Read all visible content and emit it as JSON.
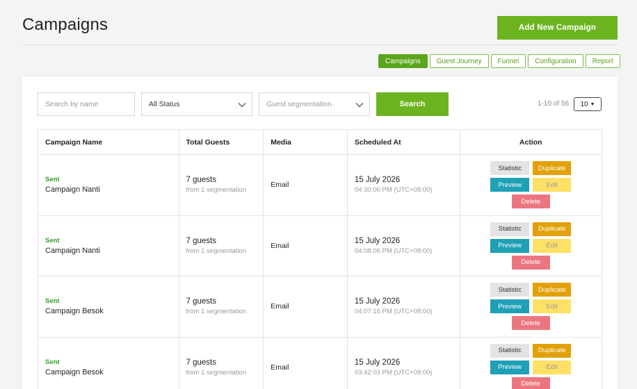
{
  "header": {
    "title": "Campaigns",
    "add_button": "Add New Campaign"
  },
  "tabs": [
    "Campaigns",
    "Guest Journey",
    "Funnel",
    "Configuration",
    "Report"
  ],
  "active_tab": "Campaigns",
  "filters": {
    "search_placeholder": "Search by name",
    "status_value": "All Status",
    "segmentation_placeholder": "Guest segmentation",
    "search_button": "Search"
  },
  "pagination": {
    "info": "1-10 of 56",
    "per_page": "10"
  },
  "table": {
    "columns": [
      "Campaign Name",
      "Total Guests",
      "Media",
      "Scheduled At",
      "Action"
    ],
    "rows": [
      {
        "status": "Sent",
        "name": "Campaign Nanti",
        "guests": "7 guests",
        "segmentation": "from 1 segmentation",
        "media": "Email",
        "date": "15 July 2026",
        "time": "04:30:00 PM (UTC+08:00)"
      },
      {
        "status": "Sent",
        "name": "Campaign Nanti",
        "guests": "7 guests",
        "segmentation": "from 1 segmentation",
        "media": "Email",
        "date": "15 July 2026",
        "time": "04:08:06 PM (UTC+08:00)"
      },
      {
        "status": "Sent",
        "name": "Campaign Besok",
        "guests": "7 guests",
        "segmentation": "from 1 segmentation",
        "media": "Email",
        "date": "15 July 2026",
        "time": "04:07:16 PM (UTC+08:00)"
      },
      {
        "status": "Sent",
        "name": "Campaign Besok",
        "guests": "7 guests",
        "segmentation": "from 1 segmentation",
        "media": "Email",
        "date": "15 July 2026",
        "time": "03:42:03 PM (UTC+08:00)"
      }
    ],
    "actions": {
      "statistic": "Statistic",
      "duplicate": "Duplicate",
      "preview": "Preview",
      "edit": "Edit",
      "delete": "Delete"
    }
  },
  "colors": {
    "primary_green": "#6cb41f",
    "sent_green": "#34a02b",
    "duplicate_orange": "#e2a109",
    "preview_teal": "#1ea0b5",
    "edit_yellow": "#ffe066",
    "delete_pink": "#ec7680"
  },
  "icons": {
    "dropdown": "chevron-down-icon",
    "per_page": "caret-down-icon"
  }
}
